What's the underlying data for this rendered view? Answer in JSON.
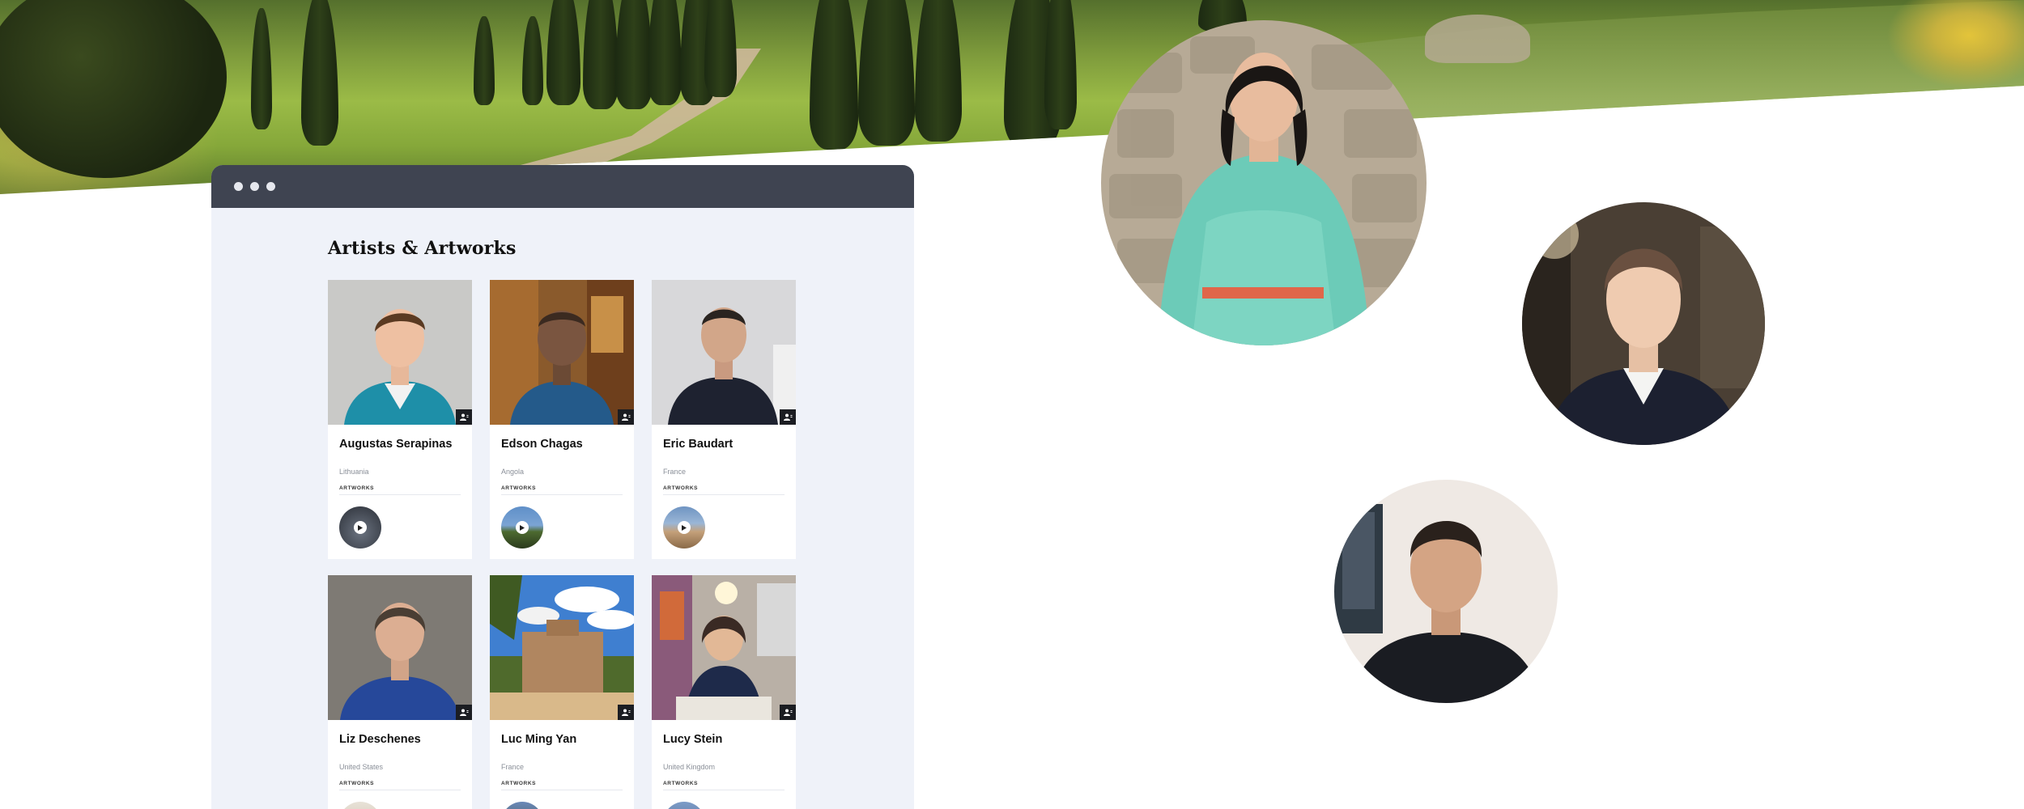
{
  "browser": {
    "page_title": "Artists & Artworks"
  },
  "artists": [
    {
      "name": "Augustas Serapinas",
      "country": "Lithuania",
      "artworks_label": "ARTWORKS"
    },
    {
      "name": "Edson Chagas",
      "country": "Angola",
      "artworks_label": "ARTWORKS"
    },
    {
      "name": "Eric Baudart",
      "country": "France",
      "artworks_label": "ARTWORKS"
    },
    {
      "name": "Liz Deschenes",
      "country": "United States",
      "artworks_label": "ARTWORKS"
    },
    {
      "name": "Luc Ming Yan",
      "country": "France",
      "artworks_label": "ARTWORKS"
    },
    {
      "name": "Lucy Stein",
      "country": "United Kingdom",
      "artworks_label": "ARTWORKS"
    }
  ],
  "icons": {
    "window_controls": "traffic-light-dots",
    "card_badge": "user-icon",
    "artwork_thumb": "play-icon"
  },
  "colors": {
    "browser_bar": "#3f4451",
    "page_background": "#eff2f9",
    "card_background": "#ffffff"
  }
}
